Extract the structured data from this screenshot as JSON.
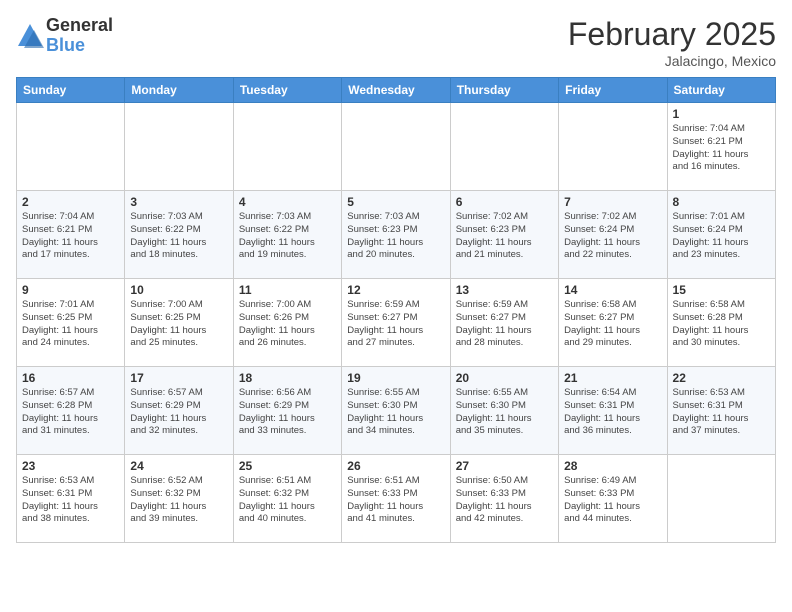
{
  "header": {
    "logo_general": "General",
    "logo_blue": "Blue",
    "month_title": "February 2025",
    "location": "Jalacingo, Mexico"
  },
  "calendar": {
    "days_of_week": [
      "Sunday",
      "Monday",
      "Tuesday",
      "Wednesday",
      "Thursday",
      "Friday",
      "Saturday"
    ],
    "weeks": [
      [
        {
          "day": "",
          "info": ""
        },
        {
          "day": "",
          "info": ""
        },
        {
          "day": "",
          "info": ""
        },
        {
          "day": "",
          "info": ""
        },
        {
          "day": "",
          "info": ""
        },
        {
          "day": "",
          "info": ""
        },
        {
          "day": "1",
          "info": "Sunrise: 7:04 AM\nSunset: 6:21 PM\nDaylight: 11 hours\nand 16 minutes."
        }
      ],
      [
        {
          "day": "2",
          "info": "Sunrise: 7:04 AM\nSunset: 6:21 PM\nDaylight: 11 hours\nand 17 minutes."
        },
        {
          "day": "3",
          "info": "Sunrise: 7:03 AM\nSunset: 6:22 PM\nDaylight: 11 hours\nand 18 minutes."
        },
        {
          "day": "4",
          "info": "Sunrise: 7:03 AM\nSunset: 6:22 PM\nDaylight: 11 hours\nand 19 minutes."
        },
        {
          "day": "5",
          "info": "Sunrise: 7:03 AM\nSunset: 6:23 PM\nDaylight: 11 hours\nand 20 minutes."
        },
        {
          "day": "6",
          "info": "Sunrise: 7:02 AM\nSunset: 6:23 PM\nDaylight: 11 hours\nand 21 minutes."
        },
        {
          "day": "7",
          "info": "Sunrise: 7:02 AM\nSunset: 6:24 PM\nDaylight: 11 hours\nand 22 minutes."
        },
        {
          "day": "8",
          "info": "Sunrise: 7:01 AM\nSunset: 6:24 PM\nDaylight: 11 hours\nand 23 minutes."
        }
      ],
      [
        {
          "day": "9",
          "info": "Sunrise: 7:01 AM\nSunset: 6:25 PM\nDaylight: 11 hours\nand 24 minutes."
        },
        {
          "day": "10",
          "info": "Sunrise: 7:00 AM\nSunset: 6:25 PM\nDaylight: 11 hours\nand 25 minutes."
        },
        {
          "day": "11",
          "info": "Sunrise: 7:00 AM\nSunset: 6:26 PM\nDaylight: 11 hours\nand 26 minutes."
        },
        {
          "day": "12",
          "info": "Sunrise: 6:59 AM\nSunset: 6:27 PM\nDaylight: 11 hours\nand 27 minutes."
        },
        {
          "day": "13",
          "info": "Sunrise: 6:59 AM\nSunset: 6:27 PM\nDaylight: 11 hours\nand 28 minutes."
        },
        {
          "day": "14",
          "info": "Sunrise: 6:58 AM\nSunset: 6:27 PM\nDaylight: 11 hours\nand 29 minutes."
        },
        {
          "day": "15",
          "info": "Sunrise: 6:58 AM\nSunset: 6:28 PM\nDaylight: 11 hours\nand 30 minutes."
        }
      ],
      [
        {
          "day": "16",
          "info": "Sunrise: 6:57 AM\nSunset: 6:28 PM\nDaylight: 11 hours\nand 31 minutes."
        },
        {
          "day": "17",
          "info": "Sunrise: 6:57 AM\nSunset: 6:29 PM\nDaylight: 11 hours\nand 32 minutes."
        },
        {
          "day": "18",
          "info": "Sunrise: 6:56 AM\nSunset: 6:29 PM\nDaylight: 11 hours\nand 33 minutes."
        },
        {
          "day": "19",
          "info": "Sunrise: 6:55 AM\nSunset: 6:30 PM\nDaylight: 11 hours\nand 34 minutes."
        },
        {
          "day": "20",
          "info": "Sunrise: 6:55 AM\nSunset: 6:30 PM\nDaylight: 11 hours\nand 35 minutes."
        },
        {
          "day": "21",
          "info": "Sunrise: 6:54 AM\nSunset: 6:31 PM\nDaylight: 11 hours\nand 36 minutes."
        },
        {
          "day": "22",
          "info": "Sunrise: 6:53 AM\nSunset: 6:31 PM\nDaylight: 11 hours\nand 37 minutes."
        }
      ],
      [
        {
          "day": "23",
          "info": "Sunrise: 6:53 AM\nSunset: 6:31 PM\nDaylight: 11 hours\nand 38 minutes."
        },
        {
          "day": "24",
          "info": "Sunrise: 6:52 AM\nSunset: 6:32 PM\nDaylight: 11 hours\nand 39 minutes."
        },
        {
          "day": "25",
          "info": "Sunrise: 6:51 AM\nSunset: 6:32 PM\nDaylight: 11 hours\nand 40 minutes."
        },
        {
          "day": "26",
          "info": "Sunrise: 6:51 AM\nSunset: 6:33 PM\nDaylight: 11 hours\nand 41 minutes."
        },
        {
          "day": "27",
          "info": "Sunrise: 6:50 AM\nSunset: 6:33 PM\nDaylight: 11 hours\nand 42 minutes."
        },
        {
          "day": "28",
          "info": "Sunrise: 6:49 AM\nSunset: 6:33 PM\nDaylight: 11 hours\nand 44 minutes."
        },
        {
          "day": "",
          "info": ""
        }
      ]
    ]
  }
}
